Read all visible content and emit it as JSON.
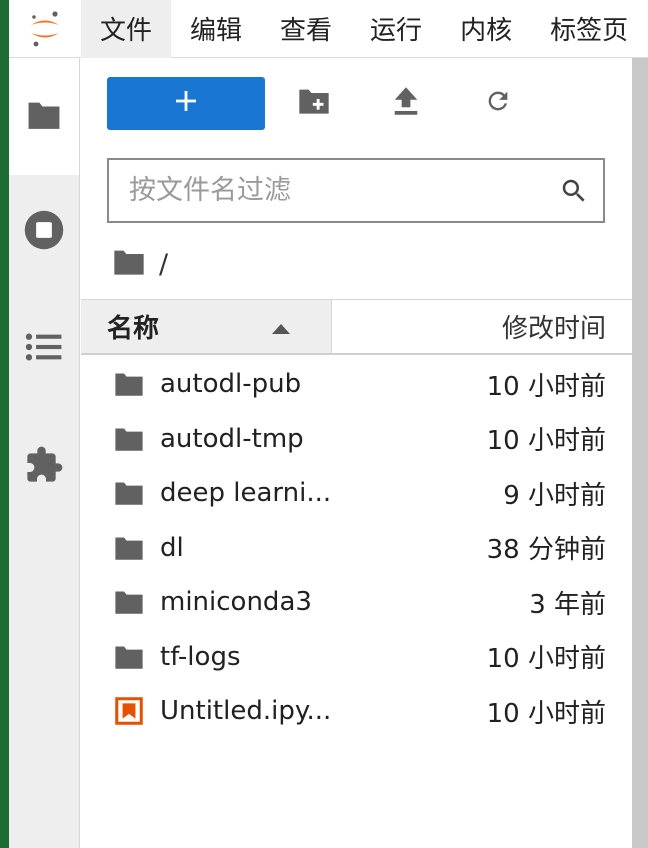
{
  "menubar": {
    "items": [
      "文件",
      "编辑",
      "查看",
      "运行",
      "内核",
      "标签页"
    ]
  },
  "sidebar": {
    "items": [
      {
        "icon": "folder-icon",
        "active": true
      },
      {
        "icon": "stop-circle-icon",
        "active": false
      },
      {
        "icon": "list-icon",
        "active": false
      },
      {
        "icon": "puzzle-extension-icon",
        "active": false
      }
    ]
  },
  "toolbar": {
    "new_label": "+",
    "icons": [
      "new-folder-icon",
      "upload-icon",
      "refresh-icon"
    ]
  },
  "filter": {
    "placeholder": "按文件名过滤",
    "value": ""
  },
  "breadcrumb": {
    "path": "/"
  },
  "list": {
    "headers": {
      "name": "名称",
      "modified": "修改时间"
    },
    "sort": "ascending",
    "rows": [
      {
        "name": "autodl-pub",
        "modified": "10 小时前",
        "type": "folder"
      },
      {
        "name": "autodl-tmp",
        "modified": "10 小时前",
        "type": "folder"
      },
      {
        "name": "deep learni...",
        "modified": "9 小时前",
        "type": "folder"
      },
      {
        "name": "dl",
        "modified": "38 分钟前",
        "type": "folder"
      },
      {
        "name": "miniconda3",
        "modified": "3 年前",
        "type": "folder"
      },
      {
        "name": "tf-logs",
        "modified": "10 小时前",
        "type": "folder"
      },
      {
        "name": "Untitled.ipy...",
        "modified": "10 小时前",
        "type": "notebook"
      }
    ]
  },
  "colors": {
    "accent": "#1976d2",
    "notebook_icon": "#e65100",
    "logo_orange": "#f37626",
    "icon_gray": "#616161"
  }
}
